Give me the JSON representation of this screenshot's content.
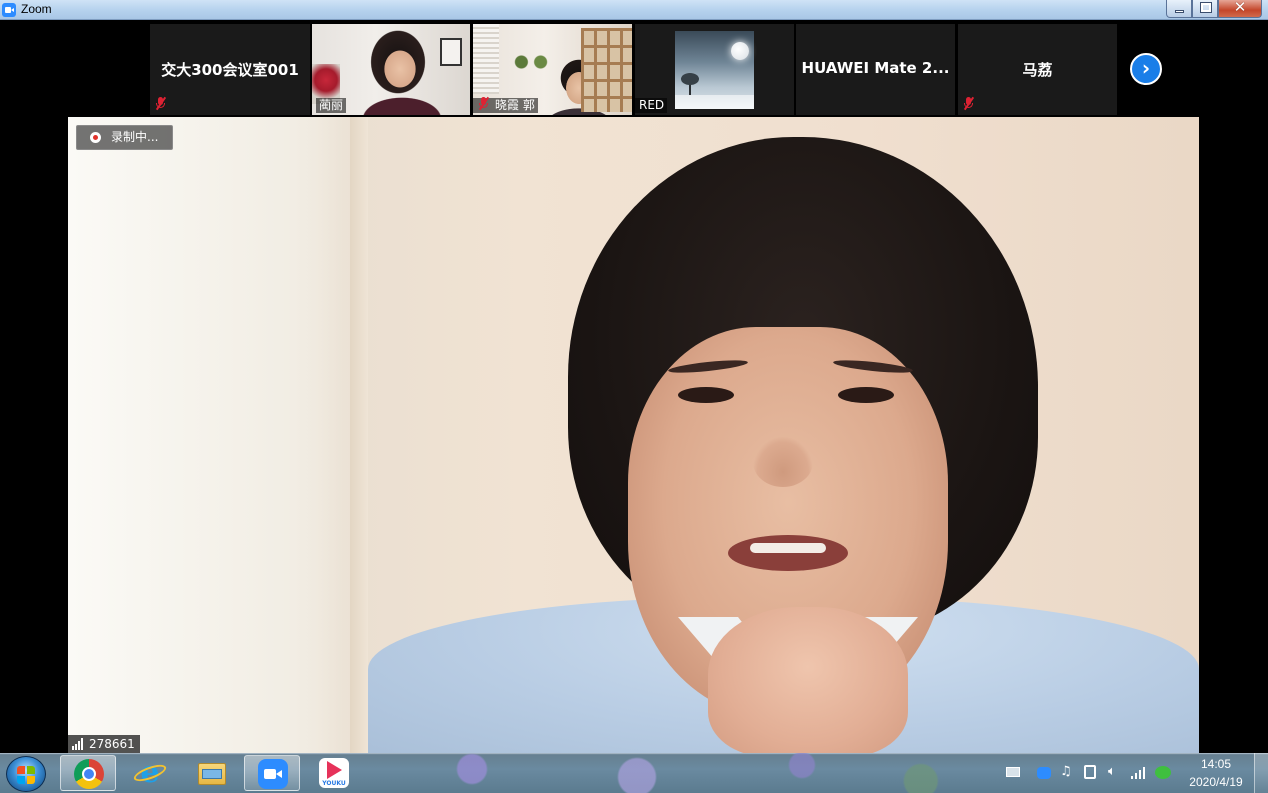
{
  "window": {
    "title": "Zoom"
  },
  "participants": [
    {
      "name": "交大300会议室001",
      "muted": true,
      "type": "name-only"
    },
    {
      "name": "蔺丽",
      "muted": false,
      "type": "video"
    },
    {
      "name": "晓霞 郭",
      "muted": true,
      "type": "video"
    },
    {
      "name": "RED",
      "muted": false,
      "type": "avatar"
    },
    {
      "name": "HUAWEI Mate 2...",
      "muted": false,
      "type": "name-only"
    },
    {
      "name": "马荔",
      "muted": true,
      "type": "name-only"
    }
  ],
  "main_video": {
    "recording_label": "录制中...",
    "meeting_id": "278661"
  },
  "taskbar": {
    "apps": [
      "chrome-icon",
      "ie-icon",
      "explorer-icon",
      "zoom-icon",
      "youku-icon"
    ],
    "active_app": "zoom-icon",
    "youku_label": "YOUKU",
    "clock_time": "14:05",
    "clock_date": "2020/4/19"
  },
  "colors": {
    "zoom_blue": "#2d8cff",
    "mute_red": "#dd2233",
    "next_button": "#1a7ee8"
  }
}
